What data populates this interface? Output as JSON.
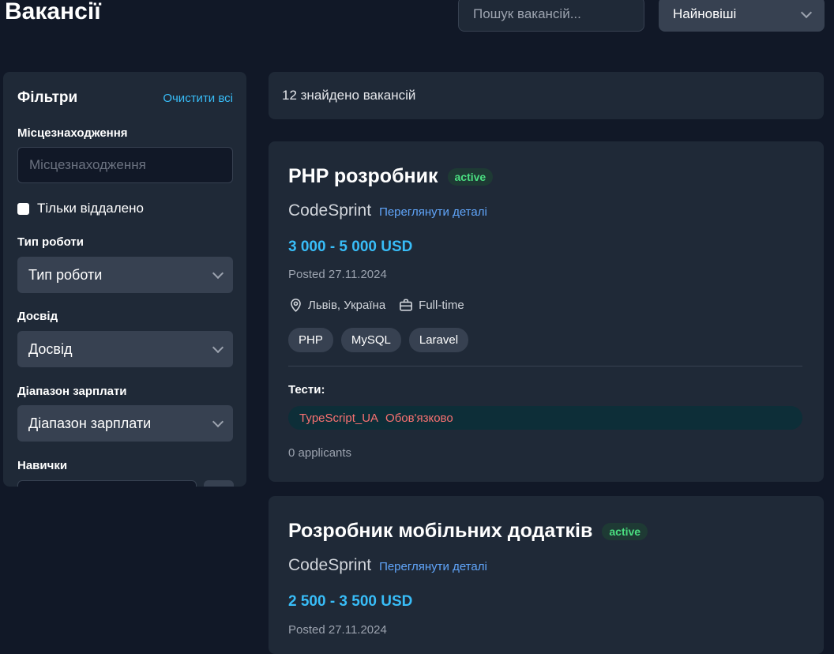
{
  "header": {
    "title": "Вакансії",
    "search_placeholder": "Пошук вакансій...",
    "sort_value": "Найновіші"
  },
  "filters": {
    "title": "Фільтри",
    "clear_all": "Очистити всі",
    "location_label": "Місцезнаходження",
    "location_placeholder": "Місцезнаходження",
    "remote_only": "Тільки віддалено",
    "remote_checked": false,
    "job_type_label": "Тип роботи",
    "job_type_value": "Тип роботи",
    "experience_label": "Досвід",
    "experience_value": "Досвід",
    "salary_label": "Діапазон зарплати",
    "salary_value": "Діапазон зарплати",
    "skills_label": "Навички"
  },
  "results": {
    "count_text": "12 знайдено вакансій"
  },
  "jobs": [
    {
      "title": "PHP розробник",
      "status": "active",
      "company": "CodeSprint",
      "details_link": "Переглянути деталі",
      "salary": "3 000 - 5 000 USD",
      "posted": "Posted 27.11.2024",
      "location": "Львів, Україна",
      "employment": "Full-time",
      "tags": [
        "PHP",
        "MySQL",
        "Laravel"
      ],
      "tests_label": "Тести:",
      "test_name": "TypeScript_UA",
      "test_required": "Обов'язково",
      "applicants": "0 applicants"
    },
    {
      "title": "Розробник мобільних додатків",
      "status": "active",
      "company": "CodeSprint",
      "details_link": "Переглянути деталі",
      "salary": "2 500 - 3 500 USD",
      "posted": "Posted 27.11.2024"
    }
  ],
  "colors": {
    "background": "#111827",
    "panel": "#1f2937",
    "accent": "#38bdf8",
    "status_green": "#4ade80",
    "required_red": "#f87171"
  }
}
